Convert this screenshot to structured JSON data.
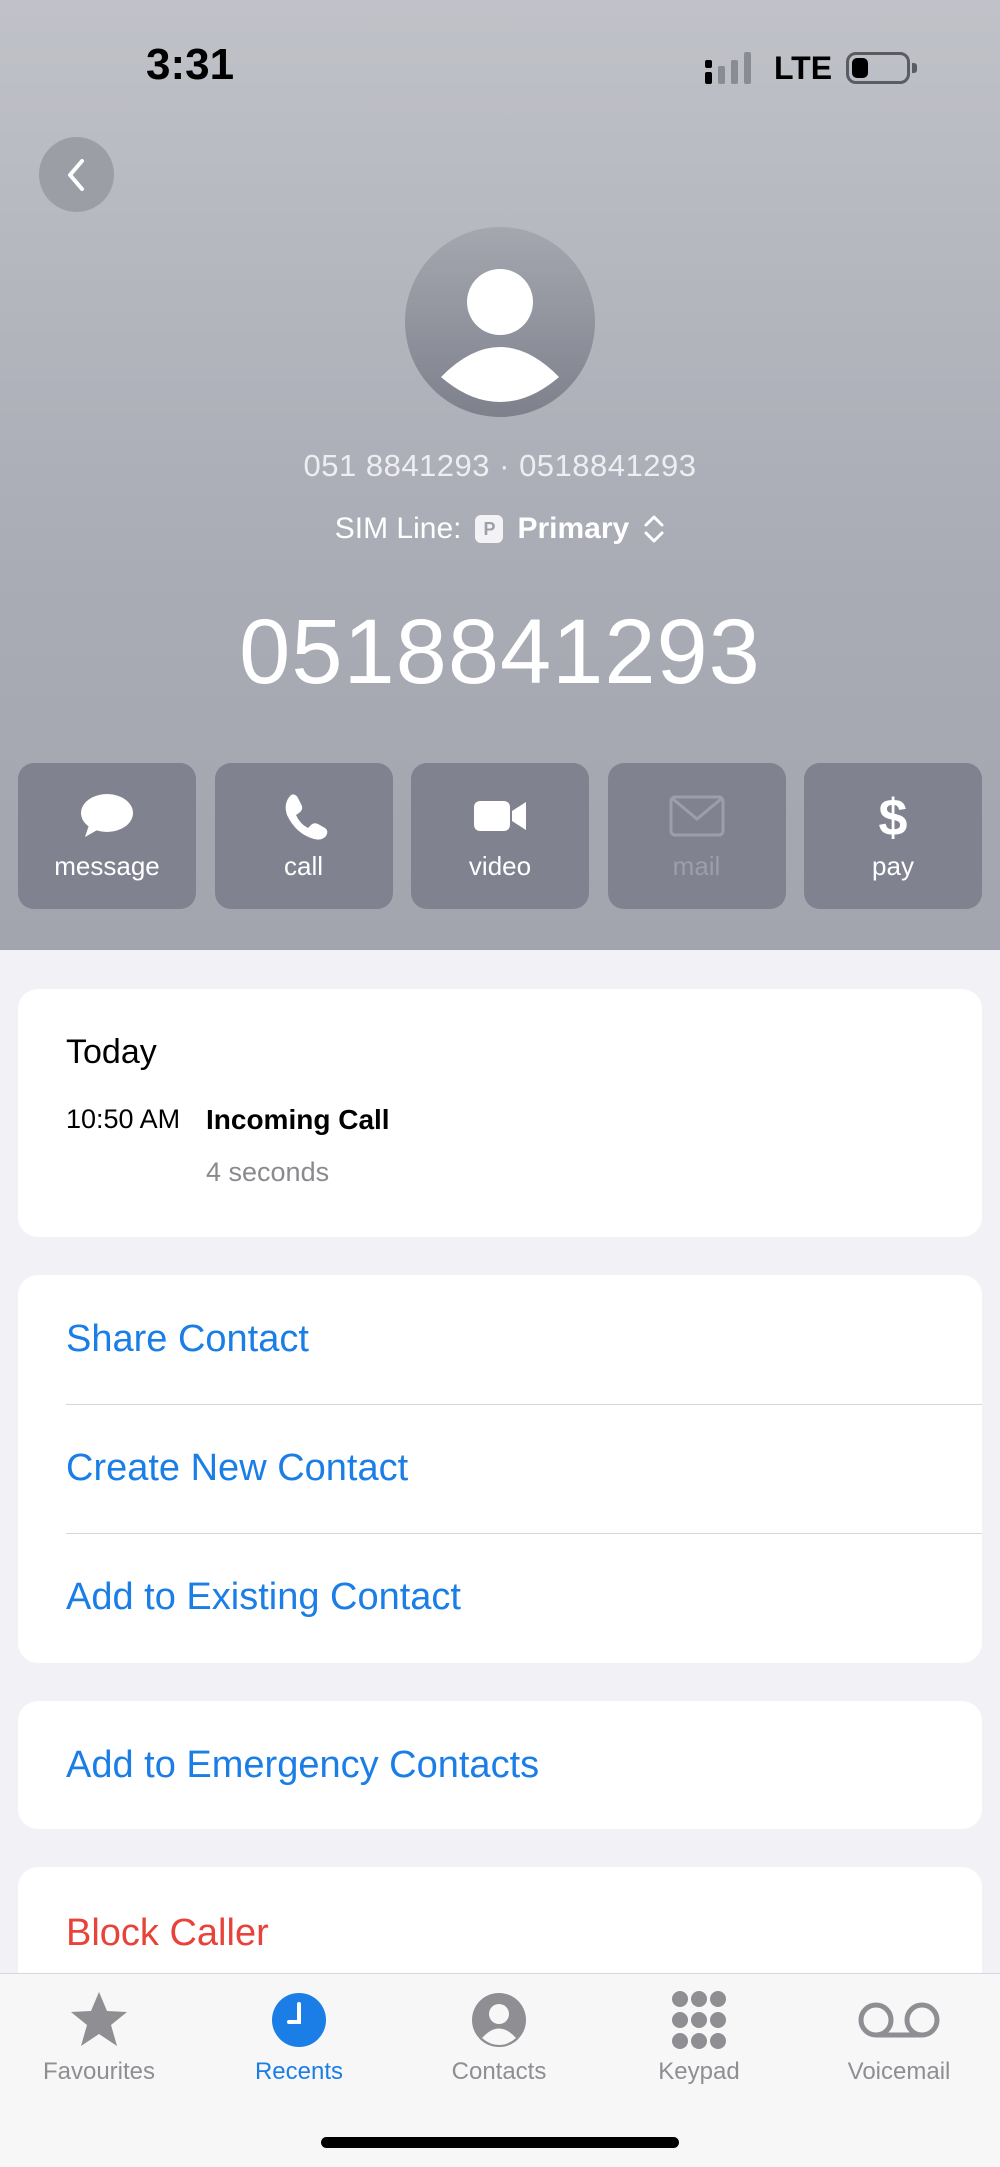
{
  "status_bar": {
    "time": "3:31",
    "network": "LTE"
  },
  "contact": {
    "sub_numbers": "051 8841293 · 0518841293",
    "sim_line_label": "SIM Line:",
    "sim_badge": "P",
    "sim_line_value": "Primary",
    "number": "0518841293"
  },
  "actions": [
    {
      "label": "message",
      "icon": "message-icon"
    },
    {
      "label": "call",
      "icon": "phone-icon"
    },
    {
      "label": "video",
      "icon": "video-icon"
    },
    {
      "label": "mail",
      "icon": "mail-icon"
    },
    {
      "label": "pay",
      "icon": "dollar-icon"
    }
  ],
  "recents": {
    "day": "Today",
    "time": "10:50 AM",
    "type": "Incoming Call",
    "duration": "4 seconds"
  },
  "options": {
    "share": "Share Contact",
    "create": "Create New Contact",
    "add_existing": "Add to Existing Contact",
    "emergency": "Add to Emergency Contacts",
    "block": "Block Caller"
  },
  "tabs": [
    {
      "label": "Favourites",
      "icon": "star-icon"
    },
    {
      "label": "Recents",
      "icon": "clock-icon"
    },
    {
      "label": "Contacts",
      "icon": "person-circle-icon"
    },
    {
      "label": "Keypad",
      "icon": "keypad-icon"
    },
    {
      "label": "Voicemail",
      "icon": "voicemail-icon"
    }
  ],
  "colors": {
    "accent": "#1a7ee6",
    "destructive": "#e8433a",
    "action_button": "#80828f"
  }
}
